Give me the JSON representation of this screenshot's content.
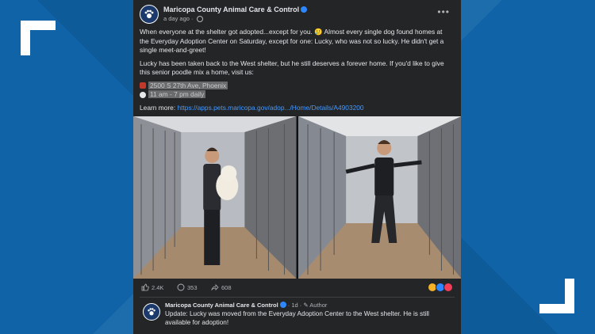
{
  "post": {
    "page_name": "Maricopa County Animal Care & Control",
    "time": "a day ago",
    "paragraph1": "When everyone at the shelter got adopted...except for you. 🥲 Almost every single dog found homes at the Everyday Adoption Center on Saturday, except for one: Lucky, who was not so lucky. He didn't get a single meet-and-greet!",
    "paragraph2": "Lucky has been taken back to the West shelter, but he still deserves a forever home. If you'd like to give this senior poodle mix a home, visit us:",
    "address": "2500 S 27th Ave, Phoenix",
    "hours": "11 am - 7 pm daily",
    "learn_more_label": "Learn more: ",
    "learn_more_link": "https://apps.pets.maricopa.gov/adop.../Home/Details/A4903200",
    "more_label": "•••"
  },
  "reactions": {
    "likes": "2.4K",
    "comments": "353",
    "shares": "608"
  },
  "comment": {
    "author": "Maricopa County Animal Care & Control",
    "meta": "· 1d · ✎ Author",
    "text": "Update: Lucky was moved from the Everyday Adoption Center to the West shelter. He is still available for adoption!"
  },
  "colors": {
    "background": "#0f63a6",
    "card": "#242526",
    "link": "#4599ff"
  }
}
